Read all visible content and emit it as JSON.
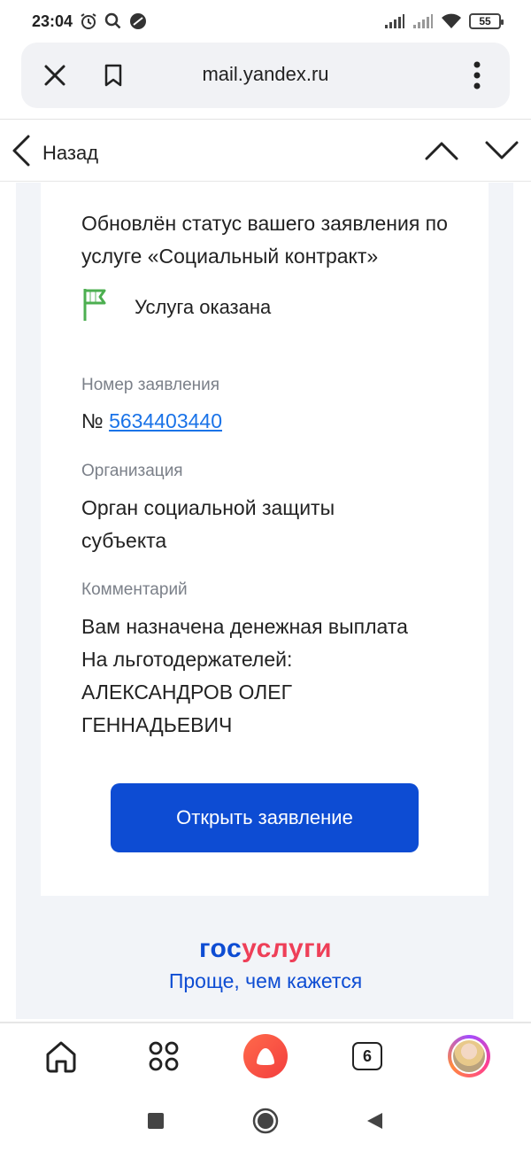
{
  "status_bar": {
    "time": "23:04",
    "battery": "55",
    "icons": [
      "alarm-icon",
      "search-icon",
      "dnd-icon",
      "signal-icon",
      "signal-icon",
      "wifi-icon",
      "battery-icon"
    ]
  },
  "browser": {
    "url": "mail.yandex.ru",
    "icons": [
      "close-icon",
      "bookmark-icon",
      "more-vertical-icon"
    ]
  },
  "mail_nav": {
    "back_label": "Назад",
    "icons": [
      "chevron-left-icon",
      "chevron-up-icon",
      "chevron-down-icon"
    ]
  },
  "letter": {
    "headline": "Обновлён статус вашего заявления по услуге «Социальный контракт»",
    "status": {
      "icon": "flag-icon",
      "label": "Услуга оказана",
      "color": "#4caf50"
    },
    "application_number": {
      "label": "Номер заявления",
      "prefix": "№",
      "value": "5634403440"
    },
    "organization": {
      "label": "Организация",
      "value": "Орган социальной защиты субъекта"
    },
    "comment": {
      "label": "Комментарий",
      "line1": "Вам назначена денежная выплата",
      "line2": "На льготодержателей:",
      "line3": "АЛЕКСАНДРОВ ОЛЕГ",
      "line4": "ГЕННАДЬЕВИЧ"
    },
    "open_button": "Открыть заявление",
    "footer": {
      "logo_part1": "гос",
      "logo_part2": "услуги",
      "slogan": "Проще, чем кажется",
      "colors": {
        "primary": "#0d4cd3",
        "accent": "#ee3f58"
      }
    }
  },
  "bottom_nav": {
    "tabs_count": "6",
    "icons": [
      "home-icon",
      "apps-icon",
      "alice-icon",
      "tabs-icon",
      "avatar"
    ]
  },
  "system_nav": {
    "icons": [
      "recents-icon",
      "home-circle-icon",
      "back-triangle-icon"
    ]
  }
}
